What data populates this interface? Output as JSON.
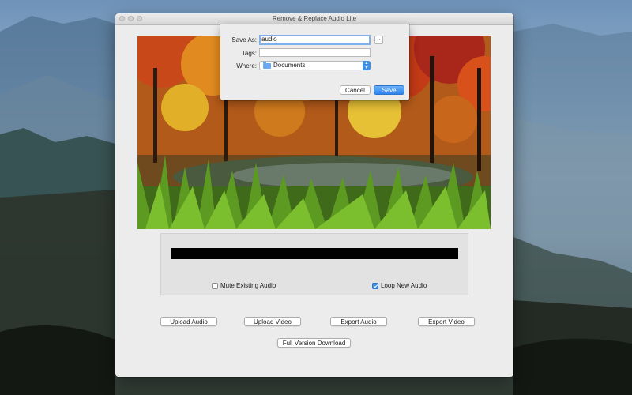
{
  "window": {
    "title": "Remove & Replace Audio Lite"
  },
  "save_dialog": {
    "save_as_label": "Save As:",
    "save_as_value": "audio",
    "tags_label": "Tags:",
    "tags_value": "",
    "where_label": "Where:",
    "where_value": "Documents",
    "where_icon": "folder-icon",
    "expand_icon": "chevron-down-icon",
    "cancel_label": "Cancel",
    "save_label": "Save",
    "accent_color": "#3d8fe8"
  },
  "options": {
    "mute_label": "Mute Existing Audio",
    "mute_checked": false,
    "loop_label": "Loop New Audio",
    "loop_checked": true
  },
  "buttons": {
    "upload_audio": "Upload Audio",
    "upload_video": "Upload Video",
    "export_audio": "Export Audio",
    "export_video": "Export Video",
    "full_version": "Full Version Download"
  }
}
